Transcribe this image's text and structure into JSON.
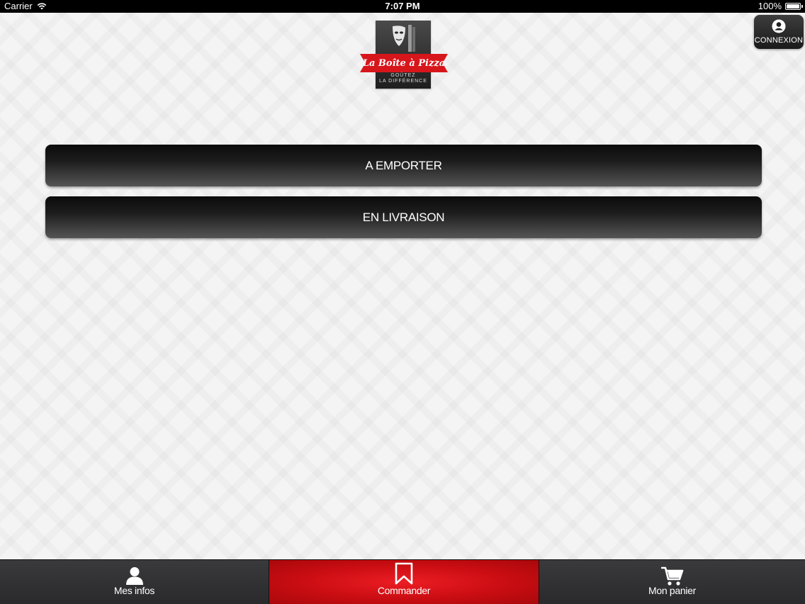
{
  "status_bar": {
    "carrier": "Carrier",
    "time": "7:07 PM",
    "battery_percent": "100%",
    "battery_level": 1.0
  },
  "header": {
    "logo": {
      "brand_name": "La Boîte à Pizza",
      "tagline_line1": "GOÛTEZ",
      "tagline_line2": "LA DIFFÉRENCE",
      "ribbon_color": "#d7161c"
    },
    "connexion_button": {
      "label": "CONNEXION",
      "icon": "user-circle-icon"
    }
  },
  "main": {
    "options": [
      {
        "label": "A EMPORTER"
      },
      {
        "label": "EN LIVRAISON"
      }
    ]
  },
  "tab_bar": {
    "tabs": [
      {
        "label": "Mes infos",
        "icon": "user-icon",
        "active": false
      },
      {
        "label": "Commander",
        "icon": "bookmark-icon",
        "active": true
      },
      {
        "label": "Mon panier",
        "icon": "cart-icon",
        "active": false
      }
    ],
    "active_color": "#e3151b",
    "inactive_color": "#2b2b2d"
  }
}
